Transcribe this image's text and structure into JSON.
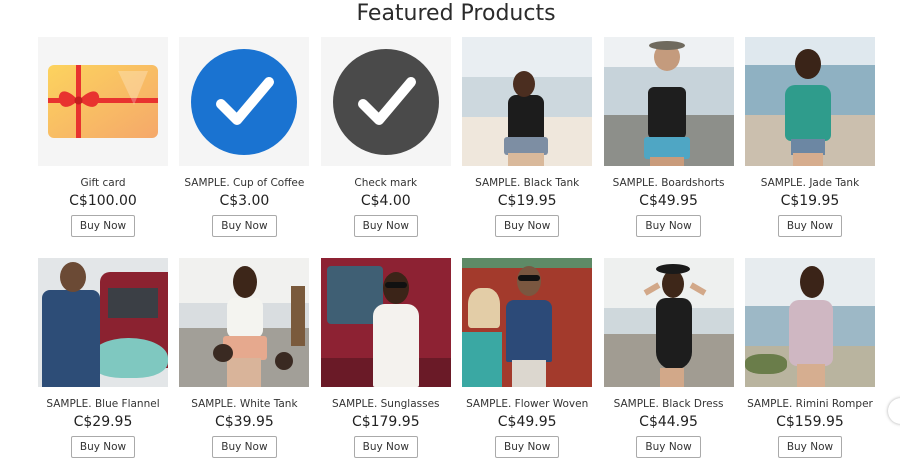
{
  "section": {
    "title": "Featured Products"
  },
  "products": [
    {
      "name": "Gift card",
      "price": "C$100.00",
      "button": "Buy Now",
      "image": "gift-card-icon"
    },
    {
      "name": "SAMPLE. Cup of Coffee",
      "price": "C$3.00",
      "button": "Buy Now",
      "image": "blue-check-icon"
    },
    {
      "name": "Check mark",
      "price": "C$4.00",
      "button": "Buy Now",
      "image": "gray-check-icon"
    },
    {
      "name": "SAMPLE. Black Tank",
      "price": "C$19.95",
      "button": "Buy Now",
      "image": "beach-photo"
    },
    {
      "name": "SAMPLE. Boardshorts",
      "price": "C$49.95",
      "button": "Buy Now",
      "image": "beach-photo"
    },
    {
      "name": "SAMPLE. Jade Tank",
      "price": "C$19.95",
      "button": "Buy Now",
      "image": "beach-photo"
    },
    {
      "name": "SAMPLE. Blue Flannel",
      "price": "C$29.95",
      "button": "Buy Now",
      "image": "surf-photo"
    },
    {
      "name": "SAMPLE. White Tank",
      "price": "C$39.95",
      "button": "Buy Now",
      "image": "beach-photo"
    },
    {
      "name": "SAMPLE. Sunglasses",
      "price": "C$179.95",
      "button": "Buy Now",
      "image": "van-photo"
    },
    {
      "name": "SAMPLE. Flower Woven",
      "price": "C$49.95",
      "button": "Buy Now",
      "image": "van-photo"
    },
    {
      "name": "SAMPLE. Black Dress",
      "price": "C$44.95",
      "button": "Buy Now",
      "image": "beach-photo"
    },
    {
      "name": "SAMPLE. Rimini Romper",
      "price": "C$159.95",
      "button": "Buy Now",
      "image": "beach-photo"
    }
  ],
  "colors": {
    "gift_card": "#f7c15a",
    "ribbon": "#e8322f",
    "check_blue": "#1a73d1",
    "check_gray": "#4a4a4a"
  }
}
